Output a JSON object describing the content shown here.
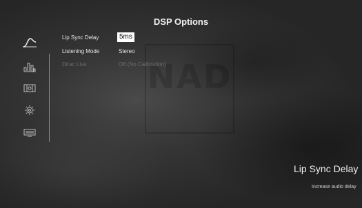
{
  "header": {
    "title": "DSP Options"
  },
  "watermark": {
    "logo_text": "NAD"
  },
  "sidebar": {
    "items": [
      {
        "icon": "eq-curve-icon",
        "selected": true
      },
      {
        "icon": "bars-levels-icon"
      },
      {
        "icon": "speaker-grid-icon"
      },
      {
        "icon": "gear-icon"
      },
      {
        "icon": "display-icon"
      }
    ]
  },
  "menu": {
    "items": [
      {
        "label": "Lip Sync Delay",
        "value": "5ms",
        "selected": true,
        "enabled": true
      },
      {
        "label": "Listening Mode",
        "value": "Stereo",
        "enabled": true
      },
      {
        "label": "Dirac Live",
        "value": "Off (No Calibration)",
        "enabled": false
      }
    ]
  },
  "help": {
    "title": "Lip Sync Delay",
    "text": "Increase audio delay"
  },
  "colors": {
    "background": "#2e2e2e",
    "text": "#e6e6e6",
    "disabled_text": "#6c6c6c",
    "selected_value_bg": "#ffffff",
    "selected_value_text": "#111111"
  }
}
